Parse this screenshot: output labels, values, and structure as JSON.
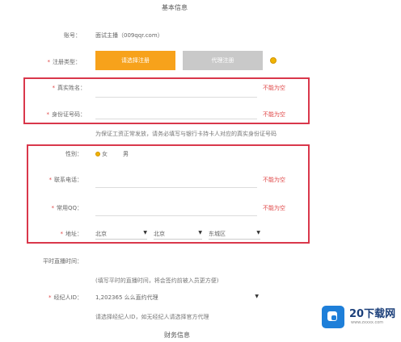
{
  "section_basic": "基本信息",
  "account": {
    "label": "账号：",
    "value": "面试主播（009qqr.com）"
  },
  "register_type": {
    "label": "注册类型：",
    "options": [
      "请选择注册",
      "代理注册"
    ]
  },
  "real_name": {
    "label": "真实姓名：",
    "error": "不能为空"
  },
  "id_number": {
    "label": "身份证号码：",
    "error": "不能为空"
  },
  "id_hint": "为保证工资正常发放，请务必填写与银行卡持卡人对应的真实身份证号码",
  "gender": {
    "label": "性别：",
    "options": [
      "女",
      "男"
    ],
    "selected": "女"
  },
  "phone": {
    "label": "联系电话：",
    "error": "不能为空"
  },
  "qq": {
    "label": "常用QQ：",
    "error": "不能为空"
  },
  "address": {
    "label": "地址：",
    "province": "北京",
    "city": "北京",
    "district": "东城区"
  },
  "live_time": {
    "label": "平时直播时间：",
    "hint": "(填写平时的直播时间，将会签约前被入员更方便)"
  },
  "agent_id": {
    "label": "经纪人ID：",
    "value": "1,202365  么么直约代理",
    "hint": "请选择经纪人ID，如无经纪人请选择官方代理"
  },
  "section_finance": "财务信息",
  "watermark": {
    "name": "20下载网",
    "url": "www.zxxxx.com"
  },
  "colors": {
    "accent": "#f7a21b",
    "error": "#e04848",
    "box": "#d9374b",
    "logo": "#1e7fd9"
  }
}
